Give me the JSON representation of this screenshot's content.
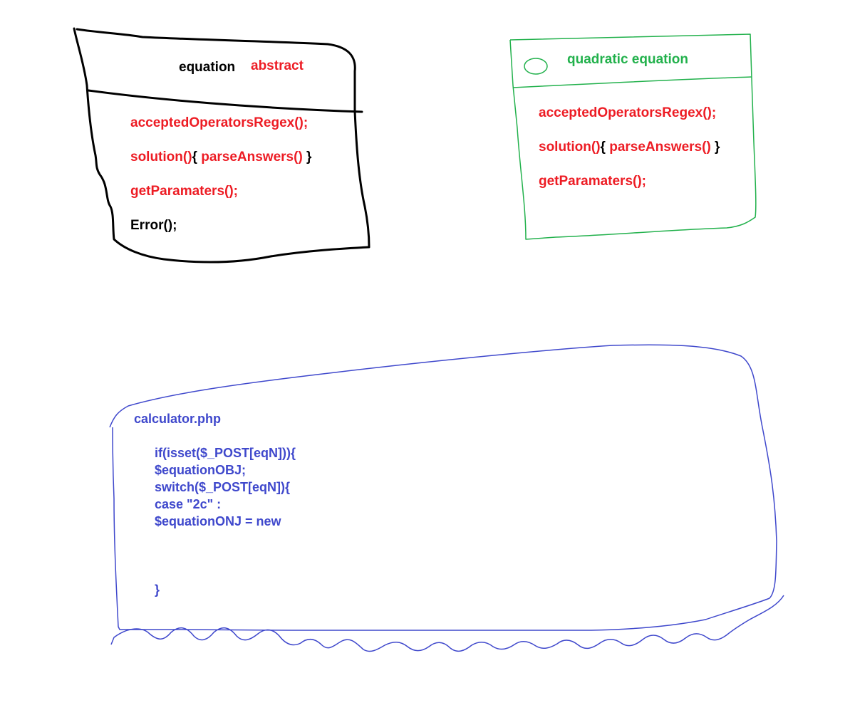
{
  "equation_box": {
    "title": "equation",
    "modifier": "abstract",
    "methods": [
      {
        "name": "acceptedOperatorsRegex();"
      },
      {
        "name": "solution()",
        "open_brace": "{",
        "inner": " parseAnswers()",
        "close_brace": " }"
      },
      {
        "name": "getParamaters();"
      },
      {
        "name": "Error();"
      }
    ]
  },
  "quadratic_box": {
    "title": "quadratic equation",
    "methods": [
      {
        "name": "acceptedOperatorsRegex();"
      },
      {
        "name": "solution()",
        "open_brace": "{",
        "inner": " parseAnswers()",
        "close_brace": " }"
      },
      {
        "name": "getParamaters();"
      }
    ]
  },
  "calculator_box": {
    "filename": "calculator.php",
    "code_lines": [
      "if(isset($_POST[eqN])){",
      "$equationOBJ;",
      "switch($_POST[eqN]){",
      "case \"2c\" :",
      "$equationONJ = new",
      "}"
    ]
  },
  "colors": {
    "outline_black": "#000000",
    "outline_green": "#22b14c",
    "outline_blue": "#3f48cc",
    "text_red": "#ed1c24",
    "text_black": "#000000",
    "text_green": "#22b14c",
    "text_blue": "#3f48cc"
  }
}
